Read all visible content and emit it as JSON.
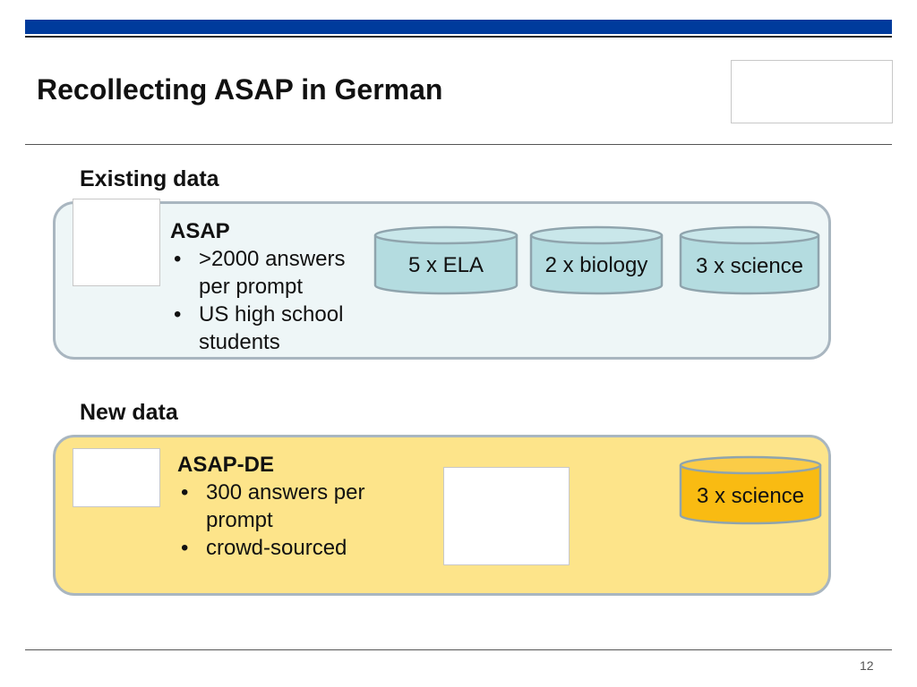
{
  "slide": {
    "title": "Recollecting ASAP in German",
    "page_number": "12"
  },
  "existing": {
    "label": "Existing data",
    "heading": "ASAP",
    "bullets": [
      ">2000 answers per prompt",
      "US high school students"
    ],
    "datasets": [
      "5 x ELA",
      "2 x biology",
      "3 x science"
    ]
  },
  "new": {
    "label": "New data",
    "heading": "ASAP-DE",
    "bullets": [
      "300 answers per prompt",
      "crowd-sourced"
    ],
    "datasets": [
      "3 x science"
    ]
  },
  "colors": {
    "header_bar": "#003b9c",
    "existing_panel": "#eef6f7",
    "new_panel": "#fde48a",
    "cylinder_existing": "#b4dce0",
    "cylinder_new": "#f9bb12"
  }
}
